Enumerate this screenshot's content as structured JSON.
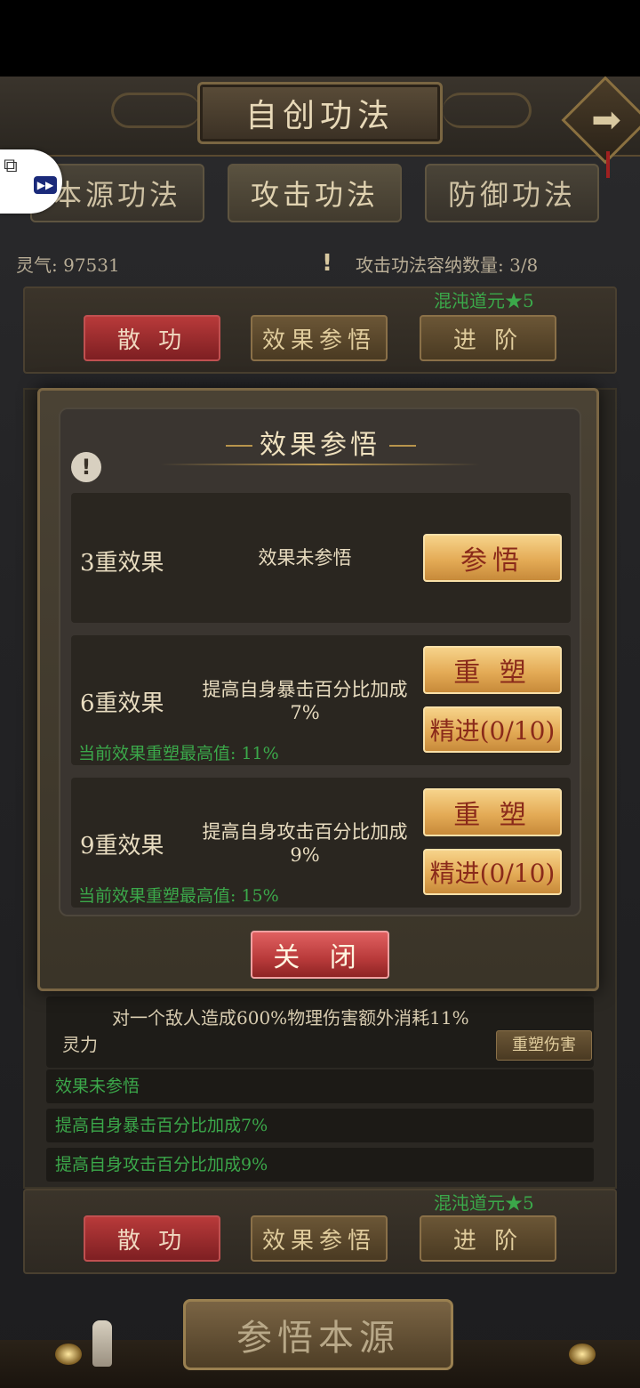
{
  "header": {
    "title": "自创功法",
    "next_arrow": "➡"
  },
  "tabs": [
    {
      "label": "本源功法"
    },
    {
      "label": "攻击功法"
    },
    {
      "label": "防御功法"
    }
  ],
  "status": {
    "lingqi": "灵气: 97531",
    "capacity": "攻击功法容纳数量: 3/8",
    "alert_glyph": "!"
  },
  "skill_card_top": {
    "rank": "混沌道元★5",
    "buttons": {
      "disperse": "散 功",
      "comprehend": "效果参悟",
      "advance": "进 阶"
    }
  },
  "skill_detail": {
    "desc_line1": "对一个敌人造成600%物理伤害额外消耗11%",
    "desc_line2": "灵力",
    "reshape_damage": "重塑伤害",
    "effects": [
      "效果未参悟",
      "提高自身暴击百分比加成7%",
      "提高自身攻击百分比加成9%"
    ]
  },
  "skill_card_bottom": {
    "rank": "混沌道元★5",
    "buttons": {
      "disperse": "散 功",
      "comprehend": "效果参悟",
      "advance": "进 阶"
    }
  },
  "bottom_button": "参悟本源",
  "modal": {
    "title": "效果参悟",
    "info_glyph": "!",
    "rows": [
      {
        "level": "3重效果",
        "effect": "效果未参悟",
        "button": "参悟"
      },
      {
        "level": "6重效果",
        "effect": "提高自身暴击百分比加成7%",
        "max": "当前效果重塑最高值: 11%",
        "reshape": "重 塑",
        "refine": "精进(0/10)"
      },
      {
        "level": "9重效果",
        "effect": "提高自身攻击百分比加成9%",
        "max": "当前效果重塑最高值: 15%",
        "reshape": "重 塑",
        "refine": "精进(0/10)"
      }
    ],
    "close": "关 闭"
  },
  "overlay": {
    "puzzle_glyph": "⧉",
    "play_glyph": "▶▶"
  },
  "colors": {
    "green_text": "#3ba84a",
    "gold_button": "#e4ab56",
    "red_button": "#b83a3a"
  }
}
